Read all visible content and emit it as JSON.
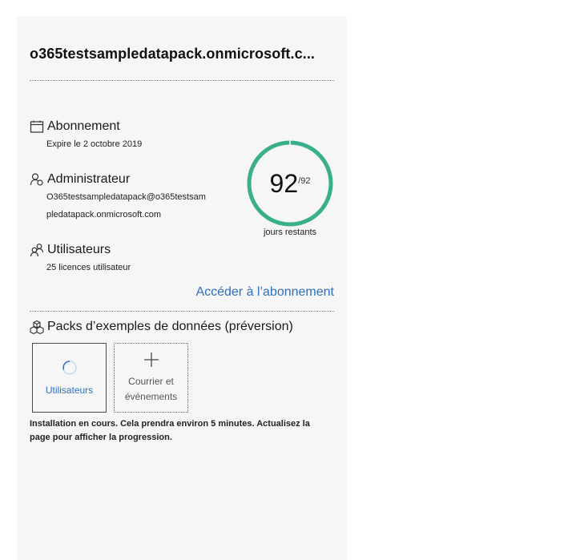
{
  "header": {
    "tenant_domain": "o365testsampledatapack.onmicrosoft.c..."
  },
  "subscription": {
    "label": "Abonnement",
    "detail": "Expire le 2 octobre 2019",
    "icon": "calendar-icon"
  },
  "administrator": {
    "label": "Administrateur",
    "email_line1": "O365testsampledatapack@o365testsam",
    "email_line2": "pledatapack.onmicrosoft.com",
    "icon": "admin-person-icon"
  },
  "users": {
    "label": "Utilisateurs",
    "detail": "25 licences utilisateur",
    "icon": "people-icon"
  },
  "countdown": {
    "remaining": "92",
    "total": "/92",
    "label": "jours restants",
    "progress_fraction": 1.0,
    "ring_color": "#3aaf8c"
  },
  "subscription_link": "Accéder à l’abonnement",
  "sample_packs": {
    "title": "Packs d’exemples de données (préversion)",
    "icon": "packages-icon",
    "tiles": [
      {
        "label": "Utilisateurs",
        "state": "installing",
        "icon": "spinner-icon"
      },
      {
        "label": "Courrier et événements",
        "state": "available",
        "icon": "plus-icon"
      }
    ],
    "status_note": "Installation en cours. Cela prendra environ 5 minutes. Actualisez la page pour afficher la progression."
  },
  "colors": {
    "accent_link": "#2f6fbf",
    "ring": "#3aaf8c",
    "panel_bg": "#f6f6f6"
  }
}
